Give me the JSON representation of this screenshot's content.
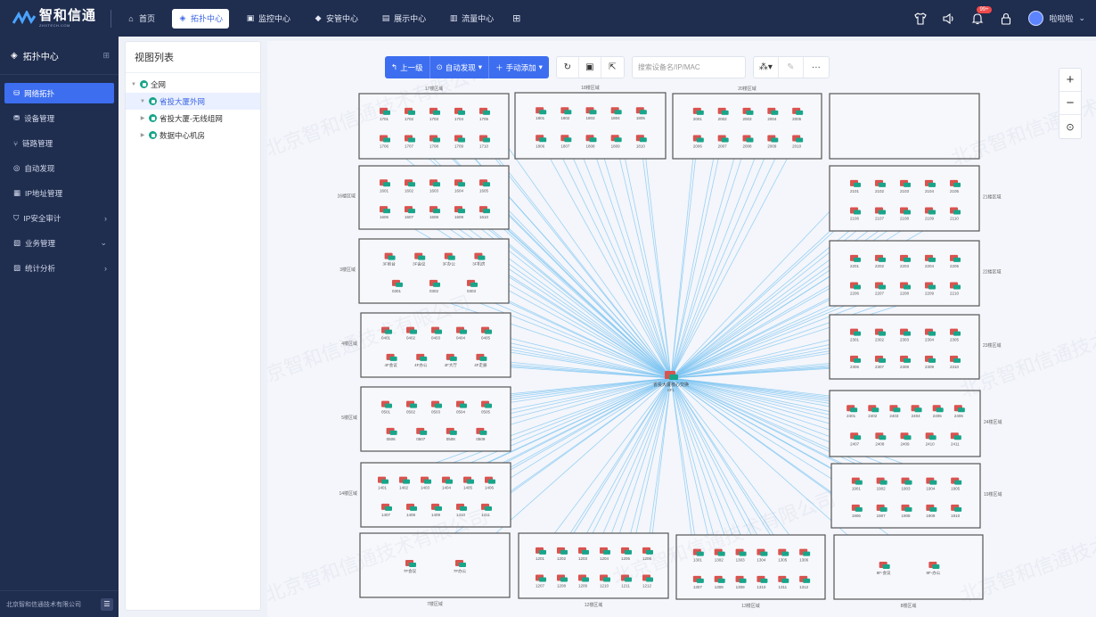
{
  "app": {
    "logo_name": "智和信通",
    "logo_sub": "ZHXTECH.COM"
  },
  "nav": {
    "items": [
      {
        "label": "首页",
        "icon": "home-icon"
      },
      {
        "label": "拓扑中心",
        "icon": "topology-icon",
        "active": true
      },
      {
        "label": "监控中心",
        "icon": "monitor-icon"
      },
      {
        "label": "安管中心",
        "icon": "shield-icon"
      },
      {
        "label": "展示中心",
        "icon": "display-icon"
      },
      {
        "label": "流量中心",
        "icon": "flow-icon"
      }
    ]
  },
  "header": {
    "badge": "99+",
    "user": "啦啦啦"
  },
  "sidebar": {
    "title": "拓扑中心",
    "items": [
      {
        "label": "网络拓扑",
        "active": true
      },
      {
        "label": "设备管理"
      },
      {
        "label": "链路管理"
      },
      {
        "label": "自动发现"
      },
      {
        "label": "IP地址管理"
      },
      {
        "label": "IP安全审计",
        "arrow": "›"
      },
      {
        "label": "业务管理",
        "arrow": "⌄"
      },
      {
        "label": "统计分析",
        "arrow": "›"
      }
    ],
    "footer": "北京智和信通技术有限公司"
  },
  "viewpanel": {
    "title": "视图列表",
    "tree": [
      {
        "label": "全网",
        "level": 0,
        "expanded": true
      },
      {
        "label": "省投大厦外网",
        "level": 1,
        "selected": true,
        "expanded": true
      },
      {
        "label": "省投大厦-无线组网",
        "level": 1
      },
      {
        "label": "数据中心机房",
        "level": 1
      }
    ]
  },
  "toolbar": {
    "up_label": "上一级",
    "auto_label": "自动发现",
    "add_label": "手动添加",
    "search_placeholder": "搜索设备名/IP/MAC"
  },
  "colors": {
    "accent": "#3d6ef0",
    "nav_bg": "#1f2d4f",
    "link": "#7cc4f2",
    "node": "#18a58a"
  },
  "topology": {
    "center": {
      "label": "省投大厦核心交换",
      "sub": "5F1"
    },
    "watermark": "北京智和信通技术有限公司",
    "regions": [
      {
        "label": "17楼区域",
        "nodes": [
          "1701",
          "1702",
          "1703",
          "1704",
          "1705",
          "1706",
          "1707",
          "1708",
          "1709",
          "1710"
        ]
      },
      {
        "label": "18楼区域",
        "nodes": [
          "1801",
          "1802",
          "1803",
          "1804",
          "1805",
          "1806",
          "1807",
          "1808",
          "1809",
          "1810"
        ]
      },
      {
        "label": "20楼区域",
        "nodes": [
          "2001",
          "2002",
          "2003",
          "2004",
          "2005",
          "2006",
          "2007",
          "2008",
          "2009",
          "2010"
        ]
      },
      {
        "label": "",
        "nodes": []
      },
      {
        "label": "16楼区域",
        "nodes": [
          "1601",
          "1602",
          "1603",
          "1604",
          "1605",
          "1606",
          "1607",
          "1608",
          "1609",
          "1610"
        ]
      },
      {
        "label": "21楼区域",
        "nodes": [
          "2101",
          "2102",
          "2103",
          "2104",
          "2105",
          "2106",
          "2107",
          "2108",
          "2109",
          "2110"
        ]
      },
      {
        "label": "3楼区域",
        "nodes": [
          "3F前台",
          "3F会议",
          "3F办公",
          "3F机房",
          "0301",
          "0302",
          "0303"
        ]
      },
      {
        "label": "22楼区域",
        "nodes": [
          "2201",
          "2202",
          "2203",
          "2204",
          "2205",
          "2206",
          "2207",
          "2208",
          "2209",
          "2210"
        ]
      },
      {
        "label": "4楼区域",
        "nodes": [
          "0401",
          "0402",
          "0403",
          "0404",
          "0405",
          "4F会议",
          "4F办公",
          "4F大厅",
          "4F走廊"
        ]
      },
      {
        "label": "23楼区域",
        "nodes": [
          "2301",
          "2302",
          "2303",
          "2304",
          "2305",
          "2306",
          "2307",
          "2308",
          "2309",
          "2310"
        ]
      },
      {
        "label": "5楼区域",
        "nodes": [
          "0501",
          "0502",
          "0503",
          "0504",
          "0505",
          "0506",
          "0507",
          "0508",
          "0509"
        ]
      },
      {
        "label": "24楼区域",
        "nodes": [
          "2401",
          "2402",
          "2403",
          "2404",
          "2405",
          "2406",
          "2407",
          "2408",
          "2409",
          "2410",
          "2411"
        ]
      },
      {
        "label": "14楼区域",
        "nodes": [
          "1401",
          "1402",
          "1403",
          "1404",
          "1405",
          "1406",
          "1407",
          "1408",
          "1409",
          "1410",
          "1411"
        ]
      },
      {
        "label": "19楼区域",
        "nodes": [
          "1901",
          "1902",
          "1903",
          "1904",
          "1905",
          "1906",
          "1907",
          "1908",
          "1909",
          "1910"
        ]
      },
      {
        "label": "7楼区域",
        "nodes": [
          "7F会议",
          "7F办公"
        ]
      },
      {
        "label": "12楼区域",
        "nodes": [
          "1201",
          "1202",
          "1203",
          "1204",
          "1205",
          "1206",
          "1207",
          "1208",
          "1209",
          "1210",
          "1211",
          "1212"
        ]
      },
      {
        "label": "13楼区域",
        "nodes": [
          "1301",
          "1302",
          "1303",
          "1304",
          "1305",
          "1306",
          "1307",
          "1308",
          "1309",
          "1310",
          "1311",
          "1312"
        ]
      },
      {
        "label": "8楼区域",
        "nodes": [
          "8F-会议",
          "8F-办公"
        ]
      }
    ]
  }
}
